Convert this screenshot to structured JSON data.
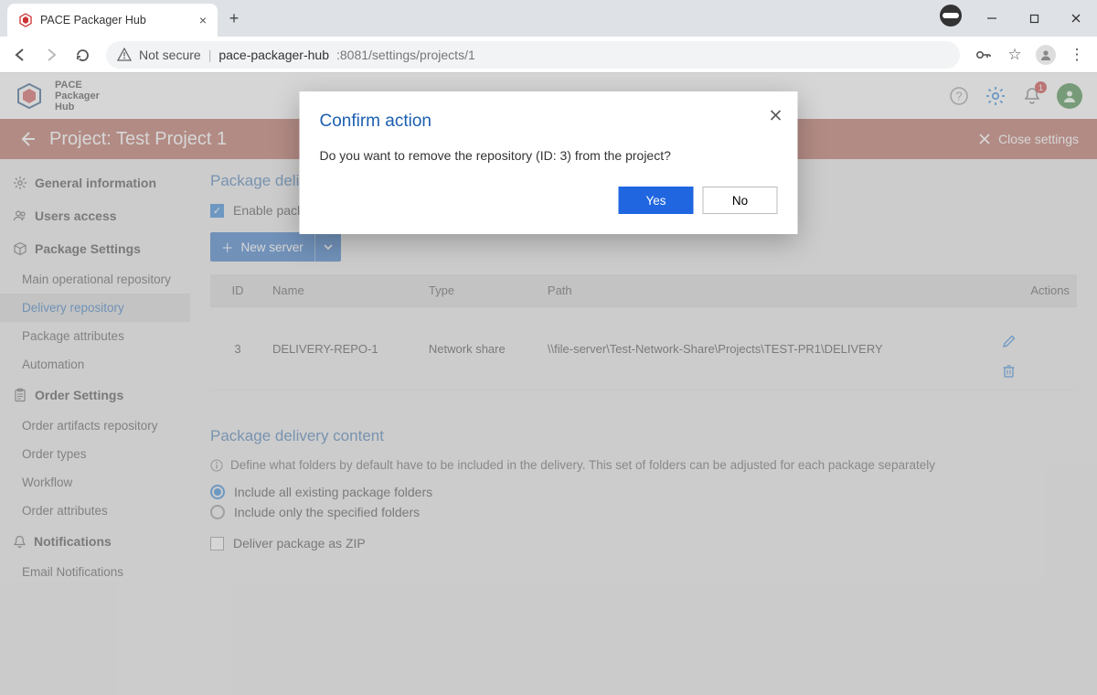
{
  "browser": {
    "tab_title": "PACE Packager Hub",
    "url_secure_label": "Not secure",
    "url_host": "pace-packager-hub",
    "url_port_path": ":8081/settings/projects/1"
  },
  "header": {
    "product_line1": "PACE",
    "product_line2": "Packager",
    "product_line3": "Hub",
    "notification_badge": "1"
  },
  "project_bar": {
    "title": "Project: Test Project 1",
    "close_label": "Close settings"
  },
  "sidebar": {
    "groups": [
      {
        "icon": "gear-icon",
        "label": "General information",
        "items": []
      },
      {
        "icon": "users-icon",
        "label": "Users access",
        "items": []
      },
      {
        "icon": "package-icon",
        "label": "Package Settings",
        "items": [
          "Main operational repository",
          "Delivery repository",
          "Package attributes",
          "Automation"
        ],
        "selected_index": 1
      },
      {
        "icon": "clipboard-icon",
        "label": "Order Settings",
        "items": [
          "Order artifacts repository",
          "Order types",
          "Workflow",
          "Order attributes"
        ]
      },
      {
        "icon": "bell-icon",
        "label": "Notifications",
        "items": [
          "Email Notifications"
        ]
      }
    ]
  },
  "main": {
    "section1_title": "Package delivery",
    "enable_checkbox_label": "Enable package delivery",
    "new_server_label": "New server",
    "table": {
      "columns": [
        "ID",
        "Name",
        "Type",
        "Path",
        "Actions"
      ],
      "rows": [
        {
          "id": "3",
          "name": "DELIVERY-REPO-1",
          "type": "Network share",
          "path": "\\\\file-server\\Test-Network-Share\\Projects\\TEST-PR1\\DELIVERY"
        }
      ]
    },
    "section2_title": "Package delivery content",
    "info_text": "Define what folders by default have to be included in the delivery. This set of folders can be adjusted for each package separately",
    "radio_all_label": "Include all existing package folders",
    "radio_specified_label": "Include only the specified folders",
    "zip_label": "Deliver package as ZIP"
  },
  "modal": {
    "title": "Confirm action",
    "body": "Do you want to remove the repository (ID: 3) from the project?",
    "yes": "Yes",
    "no": "No"
  }
}
